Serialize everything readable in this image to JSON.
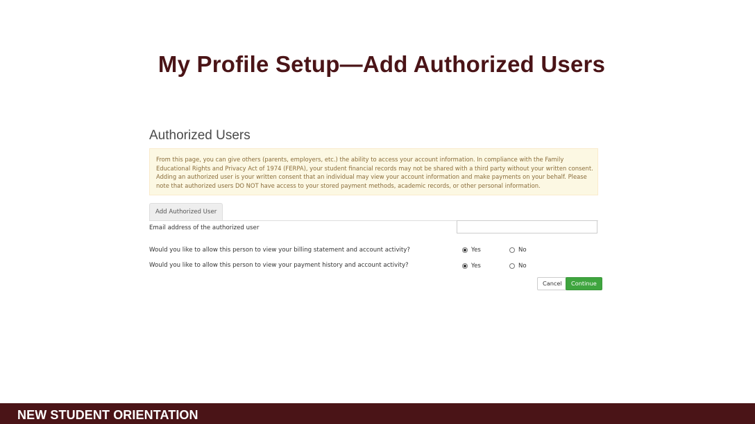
{
  "slide": {
    "title": "My Profile Setup—Add Authorized Users",
    "footer": "NEW STUDENT ORIENTATION"
  },
  "panel": {
    "heading": "Authorized Users",
    "notice": "From this page, you can give others (parents, employers, etc.) the ability to access your account information. In compliance with the Family Educational Rights and Privacy Act of 1974 (FERPA), your student financial records may not be shared with a third party without your written consent. Adding an authorized user is your written consent that an individual may view your account information and make payments on your behalf. Please note that authorized users DO NOT have access to your stored payment methods, academic records, or other personal information.",
    "tab_label": "Add Authorized User",
    "email_label": "Email address of the authorized user",
    "email_value": "",
    "question_billing": "Would you like to allow this person to view your billing statement and account activity?",
    "question_payment": "Would you like to allow this person to view your payment history and account activity?",
    "yes_label": "Yes",
    "no_label": "No",
    "billing_selected": "Yes",
    "payment_selected": "Yes",
    "cancel_label": "Cancel",
    "continue_label": "Continue"
  },
  "colors": {
    "brand_maroon": "#4a1417",
    "notice_bg": "#fcf8e3",
    "notice_text": "#8a6d3b",
    "continue_green": "#3fa53f"
  }
}
